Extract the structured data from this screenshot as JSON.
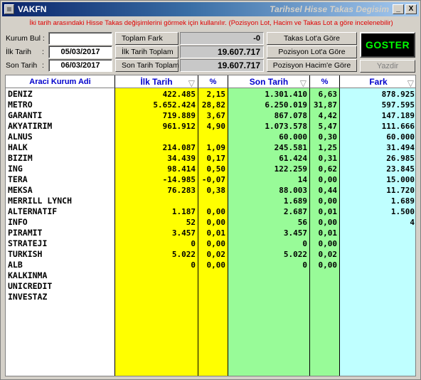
{
  "window": {
    "app_name": "VAKFN",
    "title": "Tarihsel Hisse Takas Degisim",
    "min_glyph": "_",
    "close_glyph": "X"
  },
  "info_text": "İki tarih arasındaki Hisse Takas değişimlerini görmek için kullanılır. (Pozisyon Lot, Hacim ve Takas Lot a göre incelenebilir)",
  "form": {
    "kurum_bul_label": "Kurum Bul :",
    "kurum_bul_value": "",
    "ilk_tarih_label": "İlk Tarih",
    "ilk_tarih_colon": ":",
    "ilk_tarih_value": "05/03/2017",
    "son_tarih_label": "Son Tarih",
    "son_tarih_colon": ":",
    "son_tarih_value": "06/03/2017"
  },
  "summary": {
    "toplam_fark_label": "Toplam Fark",
    "toplam_fark_value": "-0",
    "ilk_tarih_toplam_label": "İlk Tarih Toplam",
    "ilk_tarih_toplam_value": "19.607.717",
    "son_tarih_toplam_label": "Son Tarih Toplam",
    "son_tarih_toplam_value": "19.607.717"
  },
  "mode_buttons": {
    "takas_lot": "Takas Lot'a Göre",
    "pozisyon_lot": "Pozisyon Lot'a Göre",
    "pozisyon_hacim": "Pozisyon Hacim'e Göre"
  },
  "actions": {
    "goster": "GOSTER",
    "yazdir": "Yazdir"
  },
  "table": {
    "headers": {
      "kurum": "Araci Kurum Adi",
      "ilk": "İlk Tarih",
      "ilk_pct": "%",
      "son": "Son Tarih",
      "son_pct": "%",
      "fark": "Fark",
      "sort_glyph": "▽"
    },
    "rows": [
      {
        "name": "DENIZ",
        "ilk": "422.485",
        "ilk_pct": "2,15",
        "son": "1.301.410",
        "son_pct": "6,63",
        "fark": "878.925"
      },
      {
        "name": "METRO",
        "ilk": "5.652.424",
        "ilk_pct": "28,82",
        "son": "6.250.019",
        "son_pct": "31,87",
        "fark": "597.595"
      },
      {
        "name": "GARANTI",
        "ilk": "719.889",
        "ilk_pct": "3,67",
        "son": "867.078",
        "son_pct": "4,42",
        "fark": "147.189"
      },
      {
        "name": "AKYATIRIM",
        "ilk": "961.912",
        "ilk_pct": "4,90",
        "son": "1.073.578",
        "son_pct": "5,47",
        "fark": "111.666"
      },
      {
        "name": "ALNUS",
        "ilk": "",
        "ilk_pct": "",
        "son": "60.000",
        "son_pct": "0,30",
        "fark": "60.000"
      },
      {
        "name": "HALK",
        "ilk": "214.087",
        "ilk_pct": "1,09",
        "son": "245.581",
        "son_pct": "1,25",
        "fark": "31.494"
      },
      {
        "name": "BIZIM",
        "ilk": "34.439",
        "ilk_pct": "0,17",
        "son": "61.424",
        "son_pct": "0,31",
        "fark": "26.985"
      },
      {
        "name": "ING",
        "ilk": "98.414",
        "ilk_pct": "0,50",
        "son": "122.259",
        "son_pct": "0,62",
        "fark": "23.845"
      },
      {
        "name": "TERA",
        "ilk": "-14.985",
        "ilk_pct": "-0,07",
        "son": "14",
        "son_pct": "0,00",
        "fark": "15.000"
      },
      {
        "name": "MEKSA",
        "ilk": "76.283",
        "ilk_pct": "0,38",
        "son": "88.003",
        "son_pct": "0,44",
        "fark": "11.720"
      },
      {
        "name": "MERRILL LYNCH",
        "ilk": "",
        "ilk_pct": "",
        "son": "1.689",
        "son_pct": "0,00",
        "fark": "1.689"
      },
      {
        "name": "ALTERNATIF",
        "ilk": "1.187",
        "ilk_pct": "0,00",
        "son": "2.687",
        "son_pct": "0,01",
        "fark": "1.500"
      },
      {
        "name": "INFO",
        "ilk": "52",
        "ilk_pct": "0,00",
        "son": "56",
        "son_pct": "0,00",
        "fark": "4"
      },
      {
        "name": "PIRAMIT",
        "ilk": "3.457",
        "ilk_pct": "0,01",
        "son": "3.457",
        "son_pct": "0,01",
        "fark": ""
      },
      {
        "name": "STRATEJI",
        "ilk": "0",
        "ilk_pct": "0,00",
        "son": "0",
        "son_pct": "0,00",
        "fark": ""
      },
      {
        "name": "TURKISH",
        "ilk": "5.022",
        "ilk_pct": "0,02",
        "son": "5.022",
        "son_pct": "0,02",
        "fark": ""
      },
      {
        "name": "ALB",
        "ilk": "0",
        "ilk_pct": "0,00",
        "son": "0",
        "son_pct": "0,00",
        "fark": ""
      },
      {
        "name": "KALKINMA",
        "ilk": "",
        "ilk_pct": "",
        "son": "",
        "son_pct": "",
        "fark": ""
      },
      {
        "name": "UNICREDIT",
        "ilk": "",
        "ilk_pct": "",
        "son": "",
        "son_pct": "",
        "fark": ""
      },
      {
        "name": "INVESTAZ",
        "ilk": "",
        "ilk_pct": "",
        "son": "",
        "son_pct": "",
        "fark": ""
      }
    ]
  },
  "colors": {
    "ilk_column": "#ffff00",
    "son_column": "#98fb98",
    "fark_column": "#bfffff",
    "goster_text": "#00ff00",
    "info_text": "#e00000",
    "header_text": "#0000cc"
  }
}
